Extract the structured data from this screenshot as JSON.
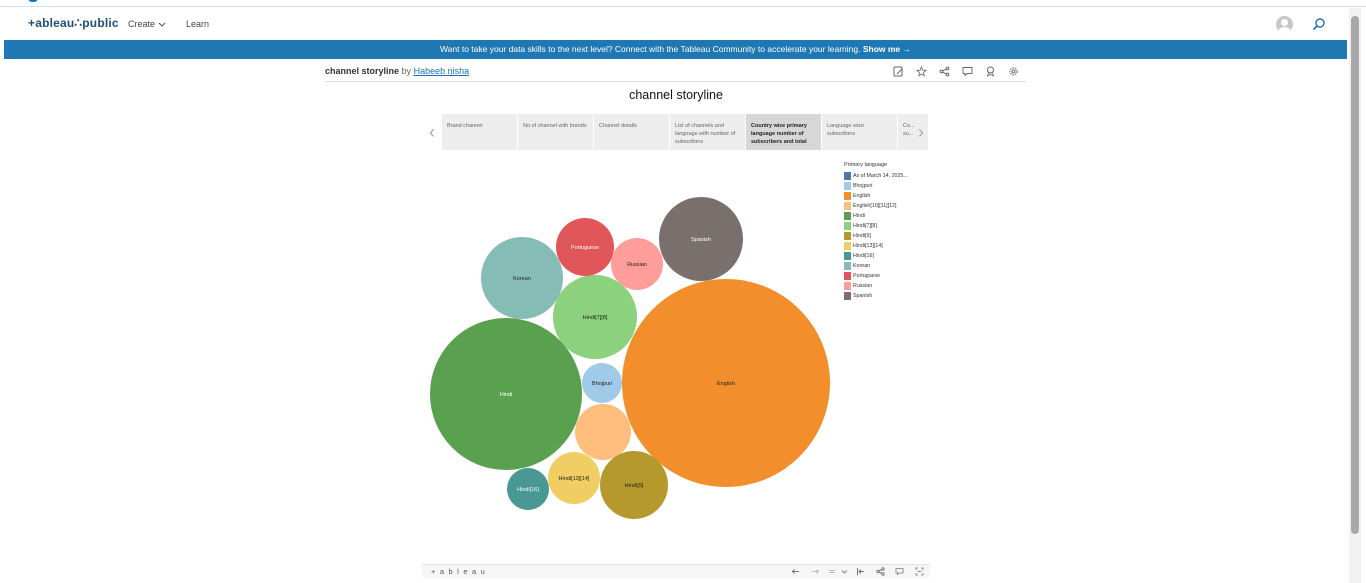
{
  "salesforce_logo": "salesforce",
  "nav": {
    "brand": "+ableau∴public",
    "create_label": "Create",
    "learn_label": "Learn"
  },
  "banner": {
    "text": "Want to take your data skills to the next level? Connect with the Tableau Community to accelerate your learning.",
    "cta": "Show me →"
  },
  "viz": {
    "title": "channel storyline",
    "by": "by",
    "author": "Habeeb nisha"
  },
  "story": {
    "title": "channel storyline",
    "points": [
      {
        "label": "Brand channel",
        "active": false
      },
      {
        "label": "No of channel with brands",
        "active": false
      },
      {
        "label": "Channel details",
        "active": false
      },
      {
        "label": "List of channels and language with number of subscribers",
        "active": false
      },
      {
        "label": "Country wize primary language number of subscribers and total",
        "active": true
      },
      {
        "label": "Language wize subscribers",
        "active": false
      },
      {
        "label": "Co... su...",
        "active": false
      }
    ]
  },
  "chart_data": {
    "type": "bubble",
    "title": "",
    "legend_title": "Primary language",
    "legend_position": "right",
    "series": [
      {
        "name": "As of March 14, 2025...",
        "color": "#4e79a7",
        "label": "",
        "size_rank": 0
      },
      {
        "name": "Bhojpuri",
        "color": "#a0cbe8",
        "label": "Bhojpuri",
        "size_rank": 3
      },
      {
        "name": "English",
        "color": "#f28e2b",
        "label": "English",
        "size_rank": 12
      },
      {
        "name": "English[10][11][12]",
        "color": "#ffbe7d",
        "label": "",
        "size_rank": 5
      },
      {
        "name": "Hindi",
        "color": "#59a14f",
        "label": "Hindi",
        "size_rank": 11
      },
      {
        "name": "Hindi[7][8]",
        "color": "#8cd17d",
        "label": "Hindi[7][8]",
        "size_rank": 9
      },
      {
        "name": "Hindi[9]",
        "color": "#b6992d",
        "label": "Hindi[9]",
        "size_rank": 7
      },
      {
        "name": "Hindi[13][14]",
        "color": "#f1ce63",
        "label": "Hindi[13][14]",
        "size_rank": 6
      },
      {
        "name": "Hindi[16]",
        "color": "#499894",
        "label": "Hindi[16]",
        "size_rank": 4
      },
      {
        "name": "Korean",
        "color": "#86bcb6",
        "label": "Korean",
        "size_rank": 8
      },
      {
        "name": "Portuguese",
        "color": "#e15759",
        "label": "Portuguese",
        "size_rank": 5
      },
      {
        "name": "Russian",
        "color": "#ff9d9a",
        "label": "Russian",
        "size_rank": 4
      },
      {
        "name": "Spanish",
        "color": "#79706e",
        "label": "Spanish",
        "size_rank": 8
      }
    ]
  },
  "toolbar": {
    "logo": "+ a b l e a u"
  }
}
